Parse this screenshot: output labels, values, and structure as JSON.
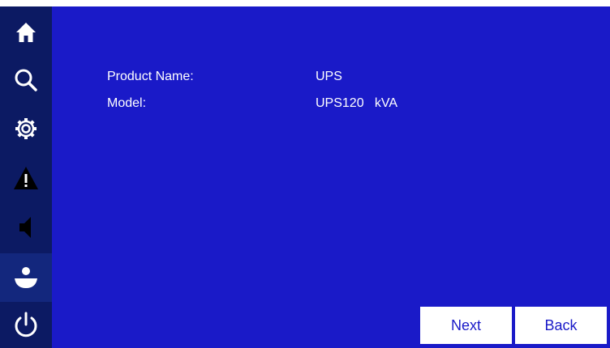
{
  "sidebar": {
    "items": [
      {
        "icon": "home-icon"
      },
      {
        "icon": "search-icon"
      },
      {
        "icon": "gear-icon"
      },
      {
        "icon": "warning-icon"
      },
      {
        "icon": "speaker-icon"
      },
      {
        "icon": "user-icon",
        "active": true
      },
      {
        "icon": "power-icon"
      }
    ]
  },
  "info": {
    "product_name_label": "Product Name:",
    "product_name_value": "UPS",
    "model_label": "Model:",
    "model_value": "UPS120   kVA"
  },
  "buttons": {
    "next_label": "Next",
    "back_label": "Back"
  },
  "colors": {
    "background": "#1a1ac8",
    "sidebar": "#0c1a63",
    "sidebar_active": "#13277d",
    "text": "#ffffff",
    "button": "#ffffff"
  }
}
